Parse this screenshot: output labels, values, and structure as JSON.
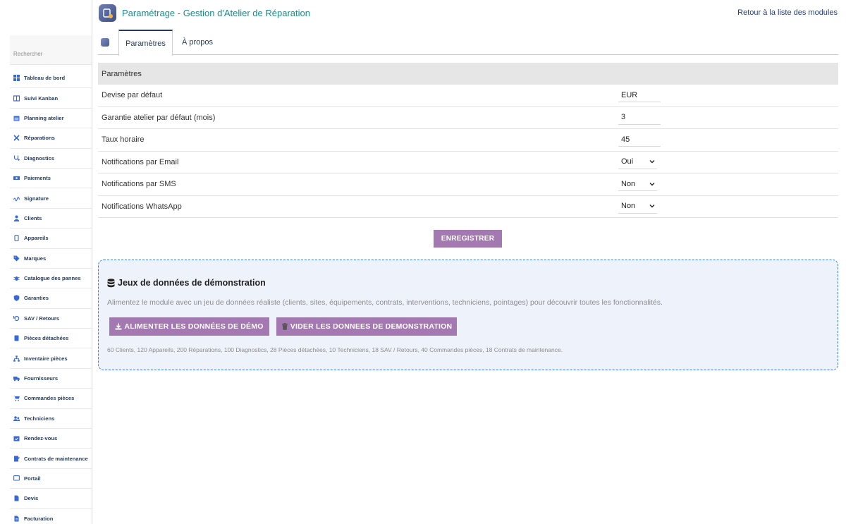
{
  "header": {
    "title": "Paramétrage - Gestion d'Atelier de Réparation",
    "back_link": "Retour à la liste des modules"
  },
  "sidebar": {
    "search_placeholder": "Rechercher",
    "items": [
      {
        "label": "Tableau de bord",
        "icon": "dashboard-icon"
      },
      {
        "label": "Suivi Kanban",
        "icon": "kanban-icon"
      },
      {
        "label": "Planning atelier",
        "icon": "calendar-icon"
      },
      {
        "label": "Réparations",
        "icon": "tools-icon"
      },
      {
        "label": "Diagnostics",
        "icon": "stethoscope-icon"
      },
      {
        "label": "Paiements",
        "icon": "money-icon"
      },
      {
        "label": "Signature",
        "icon": "signature-icon"
      },
      {
        "label": "Clients",
        "icon": "user-icon"
      },
      {
        "label": "Appareils",
        "icon": "mobile-icon"
      },
      {
        "label": "Marques",
        "icon": "tag-icon"
      },
      {
        "label": "Catalogue des pannes",
        "icon": "bug-icon"
      },
      {
        "label": "Garanties",
        "icon": "shield-icon"
      },
      {
        "label": "SAV / Retours",
        "icon": "undo-icon"
      },
      {
        "label": "Pièces détachées",
        "icon": "box-icon"
      },
      {
        "label": "Inventaire pièces",
        "icon": "sitemap-icon"
      },
      {
        "label": "Fournisseurs",
        "icon": "truck-icon"
      },
      {
        "label": "Commandes pièces",
        "icon": "cart-icon"
      },
      {
        "label": "Techniciens",
        "icon": "users-icon"
      },
      {
        "label": "Rendez-vous",
        "icon": "calendar-check-icon"
      },
      {
        "label": "Contrats de maintenance",
        "icon": "contract-icon"
      },
      {
        "label": "Portail",
        "icon": "desktop-icon"
      },
      {
        "label": "Devis",
        "icon": "file-icon"
      },
      {
        "label": "Facturation",
        "icon": "invoice-icon"
      }
    ]
  },
  "tabs": [
    {
      "label": "Paramètres",
      "active": true
    },
    {
      "label": "À propos",
      "active": false
    }
  ],
  "settings": {
    "section_title": "Paramètres",
    "rows": [
      {
        "label": "Devise par défaut",
        "value": "EUR",
        "type": "input"
      },
      {
        "label": "Garantie atelier par défaut (mois)",
        "value": "3",
        "type": "input"
      },
      {
        "label": "Taux horaire",
        "value": "45",
        "type": "input"
      },
      {
        "label": "Notifications par Email",
        "value": "Oui",
        "type": "select"
      },
      {
        "label": "Notifications par SMS",
        "value": "Non",
        "type": "select"
      },
      {
        "label": "Notifications WhatsApp",
        "value": "Non",
        "type": "select"
      }
    ],
    "save_label": "ENREGISTRER"
  },
  "demo": {
    "title": "Jeux de données de démonstration",
    "description": "Alimentez le module avec un jeu de données réaliste (clients, sites, équipements, contrats, interventions, techniciens, pointages) pour découvrir toutes les fonctionnalités.",
    "load_label": "ALIMENTER LES DONNÉES DE DÉMO",
    "clear_label": "VIDER LES DONNEES DE DEMONSTRATION",
    "stats": "60 Clients, 120 Appareils, 200 Réparations, 100 Diagnostics, 28 Pièces détachées, 10 Techniciens, 18 SAV / Retours, 40 Commandes pièces, 18 Contrats de maintenance."
  },
  "colors": {
    "accent_button": "#a478b0",
    "title_teal": "#1e8a8a",
    "menu_icon": "#3867d6",
    "demo_border": "#3a7bd5"
  }
}
